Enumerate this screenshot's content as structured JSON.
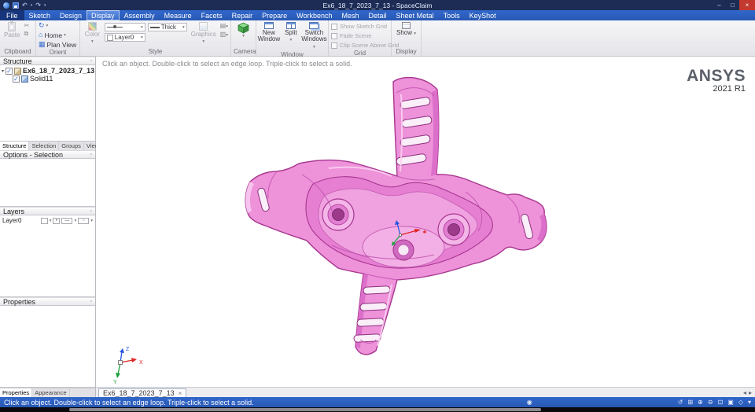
{
  "colors": {
    "titlebar_bg": "#1c2c55",
    "menubar_bg": "#2e62c4",
    "statusbar_bg": "#2e62c4",
    "close_button": "#c4392e",
    "viewport_bg": "#ffffff",
    "model_base": "#ee92da",
    "model_pocket": "#e67fd2",
    "model_floor": "#f0a2e0",
    "model_platform": "#f3b0e6",
    "model_wall": "#d86cc6",
    "model_edge": "#a8368f",
    "slot_fill": "#faeef9",
    "hole_fill": "#9e3a8a",
    "axis_x": "#e02424",
    "axis_y": "#1ca03c",
    "axis_z": "#2454e0",
    "ansys_gray": "#5b6069"
  },
  "icons": {
    "minimize": "–",
    "maximize": "□",
    "close": "×",
    "undo": "↶",
    "redo": "↷",
    "caret": "▾",
    "cut": "✂",
    "copy": "⧉",
    "spin": "↻",
    "home": "⌂",
    "plan_view": "▦",
    "pin": "▫",
    "check": "✓",
    "expander": "▾",
    "info": "◉",
    "rotate": "↺",
    "pan": "⊞",
    "zoom_in": "⊕",
    "zoom_out": "⊖",
    "zoom_fit": "⊡",
    "view_cube": "▣",
    "display_style": "◇",
    "tab_close": "×",
    "nav_left": "◂",
    "nav_right": "▸"
  },
  "titlebar": {
    "title": "Ex6_18_7_2023_7_13 - SpaceClaim"
  },
  "menu": {
    "tabs": [
      "File",
      "Sketch",
      "Design",
      "Display",
      "Assembly",
      "Measure",
      "Facets",
      "Repair",
      "Prepare",
      "Workbench",
      "Mesh",
      "Detail",
      "Sheet Metal",
      "Tools",
      "KeyShot"
    ],
    "active_tab": "Display"
  },
  "ribbon": {
    "clipboard": {
      "label": "Clipboard",
      "paste": "Paste"
    },
    "orient": {
      "label": "Orient",
      "home": "Home",
      "plan_view": "Plan View"
    },
    "style": {
      "label": "Style",
      "color": "Color",
      "layer": "Layer0",
      "thickness": "Thick",
      "graphics": "Graphics"
    },
    "camera": {
      "label": "Camera"
    },
    "window": {
      "label": "Window",
      "new_window": "New Window",
      "split": "Split",
      "switch_windows": "Switch Windows"
    },
    "grid": {
      "label": "Grid",
      "show_grid": "Show Sketch Grid",
      "fade_scene": "Fade Scene",
      "clip_scene": "Clip Scene Above Grid"
    },
    "display": {
      "label": "Display",
      "show": "Show"
    }
  },
  "left_panel": {
    "structure": {
      "header": "Structure",
      "root": "Ex6_18_7_2023_7_13",
      "child": "Solid11",
      "tabs": [
        "Structure",
        "Selection",
        "Groups",
        "Views"
      ],
      "active_tab": "Structure"
    },
    "options": {
      "header": "Options - Selection"
    },
    "layers": {
      "header": "Layers",
      "layer_name": "Layer0"
    },
    "properties": {
      "header": "Properties"
    },
    "bottom_tabs": [
      "Properties",
      "Appearance"
    ],
    "active_bottom_tab": "Properties"
  },
  "viewport": {
    "hint": "Click an object. Double-click to select an edge loop. Triple-click to select a solid.",
    "brand_name": "ANSYS",
    "brand_release": "2021 R1",
    "doc_tab": "Ex6_18_7_2023_7_13",
    "axes": {
      "x": "X",
      "y": "Y",
      "z": "Z"
    }
  },
  "status_bar": {
    "message": "Click an object. Double-click to select an edge loop. Triple-click to select a solid."
  }
}
